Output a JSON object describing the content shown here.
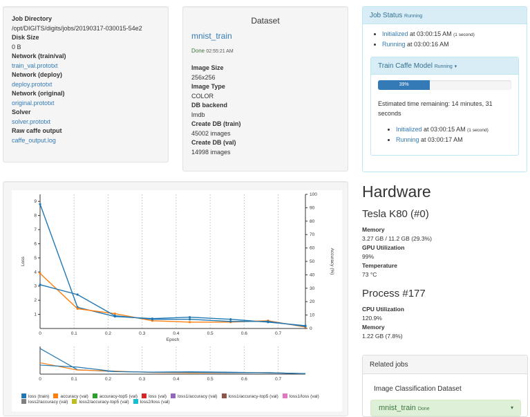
{
  "job_info": {
    "job_directory_label": "Job Directory",
    "job_directory": "/opt/DIGITS/digits/jobs/20190317-030015-54e2",
    "disk_size_label": "Disk Size",
    "disk_size": "0 B",
    "network_trainval_label": "Network (train/val)",
    "network_trainval": "train_val.prototxt",
    "network_deploy_label": "Network (deploy)",
    "network_deploy": "deploy.prototxt",
    "network_original_label": "Network (original)",
    "network_original": "original.prototxt",
    "solver_label": "Solver",
    "solver": "solver.prototxt",
    "raw_output_label": "Raw caffe output",
    "raw_output": "caffe_output.log"
  },
  "dataset": {
    "title": "Dataset",
    "name": "mnist_train",
    "status": "Done",
    "status_time": "02:55:21 AM",
    "image_size_label": "Image Size",
    "image_size": "256x256",
    "image_type_label": "Image Type",
    "image_type": "COLOR",
    "db_backend_label": "DB backend",
    "db_backend": "lmdb",
    "create_train_label": "Create DB (train)",
    "create_train": "45002 images",
    "create_val_label": "Create DB (val)",
    "create_val": "14998 images"
  },
  "job_status": {
    "title": "Job Status",
    "state": "Running",
    "history": [
      {
        "state": "Initialized",
        "at": "at 03:00:15 AM",
        "dur": "(1 second)"
      },
      {
        "state": "Running",
        "at": "at 03:00:16 AM",
        "dur": ""
      }
    ],
    "train": {
      "title": "Train Caffe Model",
      "state": "Running",
      "caret": "▾",
      "progress_label": "39%",
      "progress": 39,
      "eta": "Estimated time remaining: 14 minutes, 31 seconds",
      "history": [
        {
          "state": "Initialized",
          "at": "at 03:00:15 AM",
          "dur": "(1 second)"
        },
        {
          "state": "Running",
          "at": "at 03:00:17 AM",
          "dur": ""
        }
      ]
    }
  },
  "chart_data": {
    "type": "line",
    "xlabel": "Epoch",
    "ylabel": "Loss",
    "y2label": "Accuracy (%)",
    "xlim": [
      0,
      0.78
    ],
    "ylim": [
      0,
      9.5
    ],
    "y2lim": [
      0,
      100
    ],
    "x_ticks": [
      "0",
      "0.1",
      "0.2",
      "0.3",
      "0.4",
      "0.5",
      "0.6",
      "0.7"
    ],
    "y_ticks": [
      "1",
      "2",
      "3",
      "4",
      "5",
      "6",
      "7",
      "8",
      "9"
    ],
    "y2_ticks": [
      "0",
      "10",
      "20",
      "30",
      "40",
      "50",
      "60",
      "70",
      "80",
      "90",
      "100"
    ],
    "series": [
      {
        "name": "loss (train)",
        "color": "#1f77b4",
        "axis": "left",
        "x": [
          0,
          0.11,
          0.22,
          0.33,
          0.44,
          0.56,
          0.67,
          0.78
        ],
        "y": [
          8.8,
          1.5,
          0.85,
          0.7,
          0.8,
          0.65,
          0.45,
          0.2
        ]
      },
      {
        "name": "accuracy (val)",
        "color": "#ff7f0e",
        "axis": "left",
        "x": [
          0,
          0.11,
          0.22,
          0.33,
          0.44,
          0.56,
          0.67,
          0.78
        ],
        "y": [
          3.9,
          1.4,
          1.05,
          0.55,
          0.45,
          0.45,
          0.55,
          0.1
        ]
      },
      {
        "name": "loss (val)",
        "color": "#1f77b4",
        "axis": "left",
        "x": [
          0,
          0.11,
          0.22,
          0.33,
          0.44,
          0.56,
          0.67,
          0.78
        ],
        "y": [
          3.1,
          2.4,
          0.9,
          0.65,
          0.65,
          0.5,
          0.5,
          0.15
        ]
      }
    ],
    "legend": [
      {
        "name": "loss (train)",
        "color": "#1f77b4"
      },
      {
        "name": "accuracy (val)",
        "color": "#ff7f0e"
      },
      {
        "name": "accuracy-top5 (val)",
        "color": "#2ca02c"
      },
      {
        "name": "loss (val)",
        "color": "#d62728"
      },
      {
        "name": "loss1/accuracy (val)",
        "color": "#9467bd"
      },
      {
        "name": "loss1/accuracy-top5 (val)",
        "color": "#8c564b"
      },
      {
        "name": "loss1/loss (val)",
        "color": "#e377c2"
      },
      {
        "name": "loss2/accuracy (val)",
        "color": "#7f7f7f"
      },
      {
        "name": "loss2/accuracy-top5 (val)",
        "color": "#bcbd22"
      },
      {
        "name": "loss2/loss (val)",
        "color": "#17becf"
      }
    ]
  },
  "hardware": {
    "title": "Hardware",
    "gpu_name": "Tesla K80 (#0)",
    "memory_label": "Memory",
    "memory": "3.27 GB / 11.2 GB (29.3%)",
    "util_label": "GPU Utilization",
    "util": "99%",
    "temp_label": "Temperature",
    "temp": "73 °C",
    "process_title": "Process #177",
    "cpu_label": "CPU Utilization",
    "cpu": "120.9%",
    "pmem_label": "Memory",
    "pmem": "1.22 GB (7.8%)"
  },
  "related": {
    "title": "Related jobs",
    "subtitle": "Image Classification Dataset",
    "item_name": "mnist_train",
    "item_status": "Done",
    "item_caret": "▾"
  }
}
